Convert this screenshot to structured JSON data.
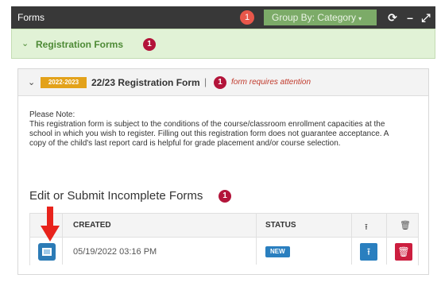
{
  "topbar": {
    "title": "Forms",
    "count": "1",
    "group_by": "Group By: Category",
    "caret_icon": "▾",
    "refresh_icon": "⟳",
    "minimize_icon": "–",
    "expand_icon": "⤢"
  },
  "section": {
    "chevron_icon": "⌄",
    "label": "Registration Forms",
    "count": "1"
  },
  "form": {
    "chevron_icon": "⌄",
    "year_tag": "2022-2023",
    "title": "22/23 Registration Form",
    "separator": "|",
    "attention_count": "1",
    "attention_text": "form requires attention",
    "note_heading": "Please Note:",
    "note_body": "This registration form is subject to the conditions of the course/classroom enrollment capacities at the school in which you wish to register. Filling out this registration form does not guarantee acceptance. A copy of the child's last report card is helpful for grade placement and/or course selection."
  },
  "incomplete": {
    "title": "Edit or Submit Incomplete Forms",
    "count": "1"
  },
  "table": {
    "headers": {
      "created": "CREATED",
      "status": "STATUS"
    },
    "rows": [
      {
        "created": "05/19/2022 03:16 PM",
        "status": "NEW"
      }
    ]
  },
  "colors": {
    "topbar": "#383838",
    "group_by": "#7cab68",
    "section_bg": "#e1f2d6",
    "section_text": "#4d8a35",
    "badge_dark": "#b3143a",
    "year_tag": "#e3a21a",
    "primary": "#2a7fbf",
    "danger": "#cc1e3f",
    "arrow": "#e8231c"
  }
}
